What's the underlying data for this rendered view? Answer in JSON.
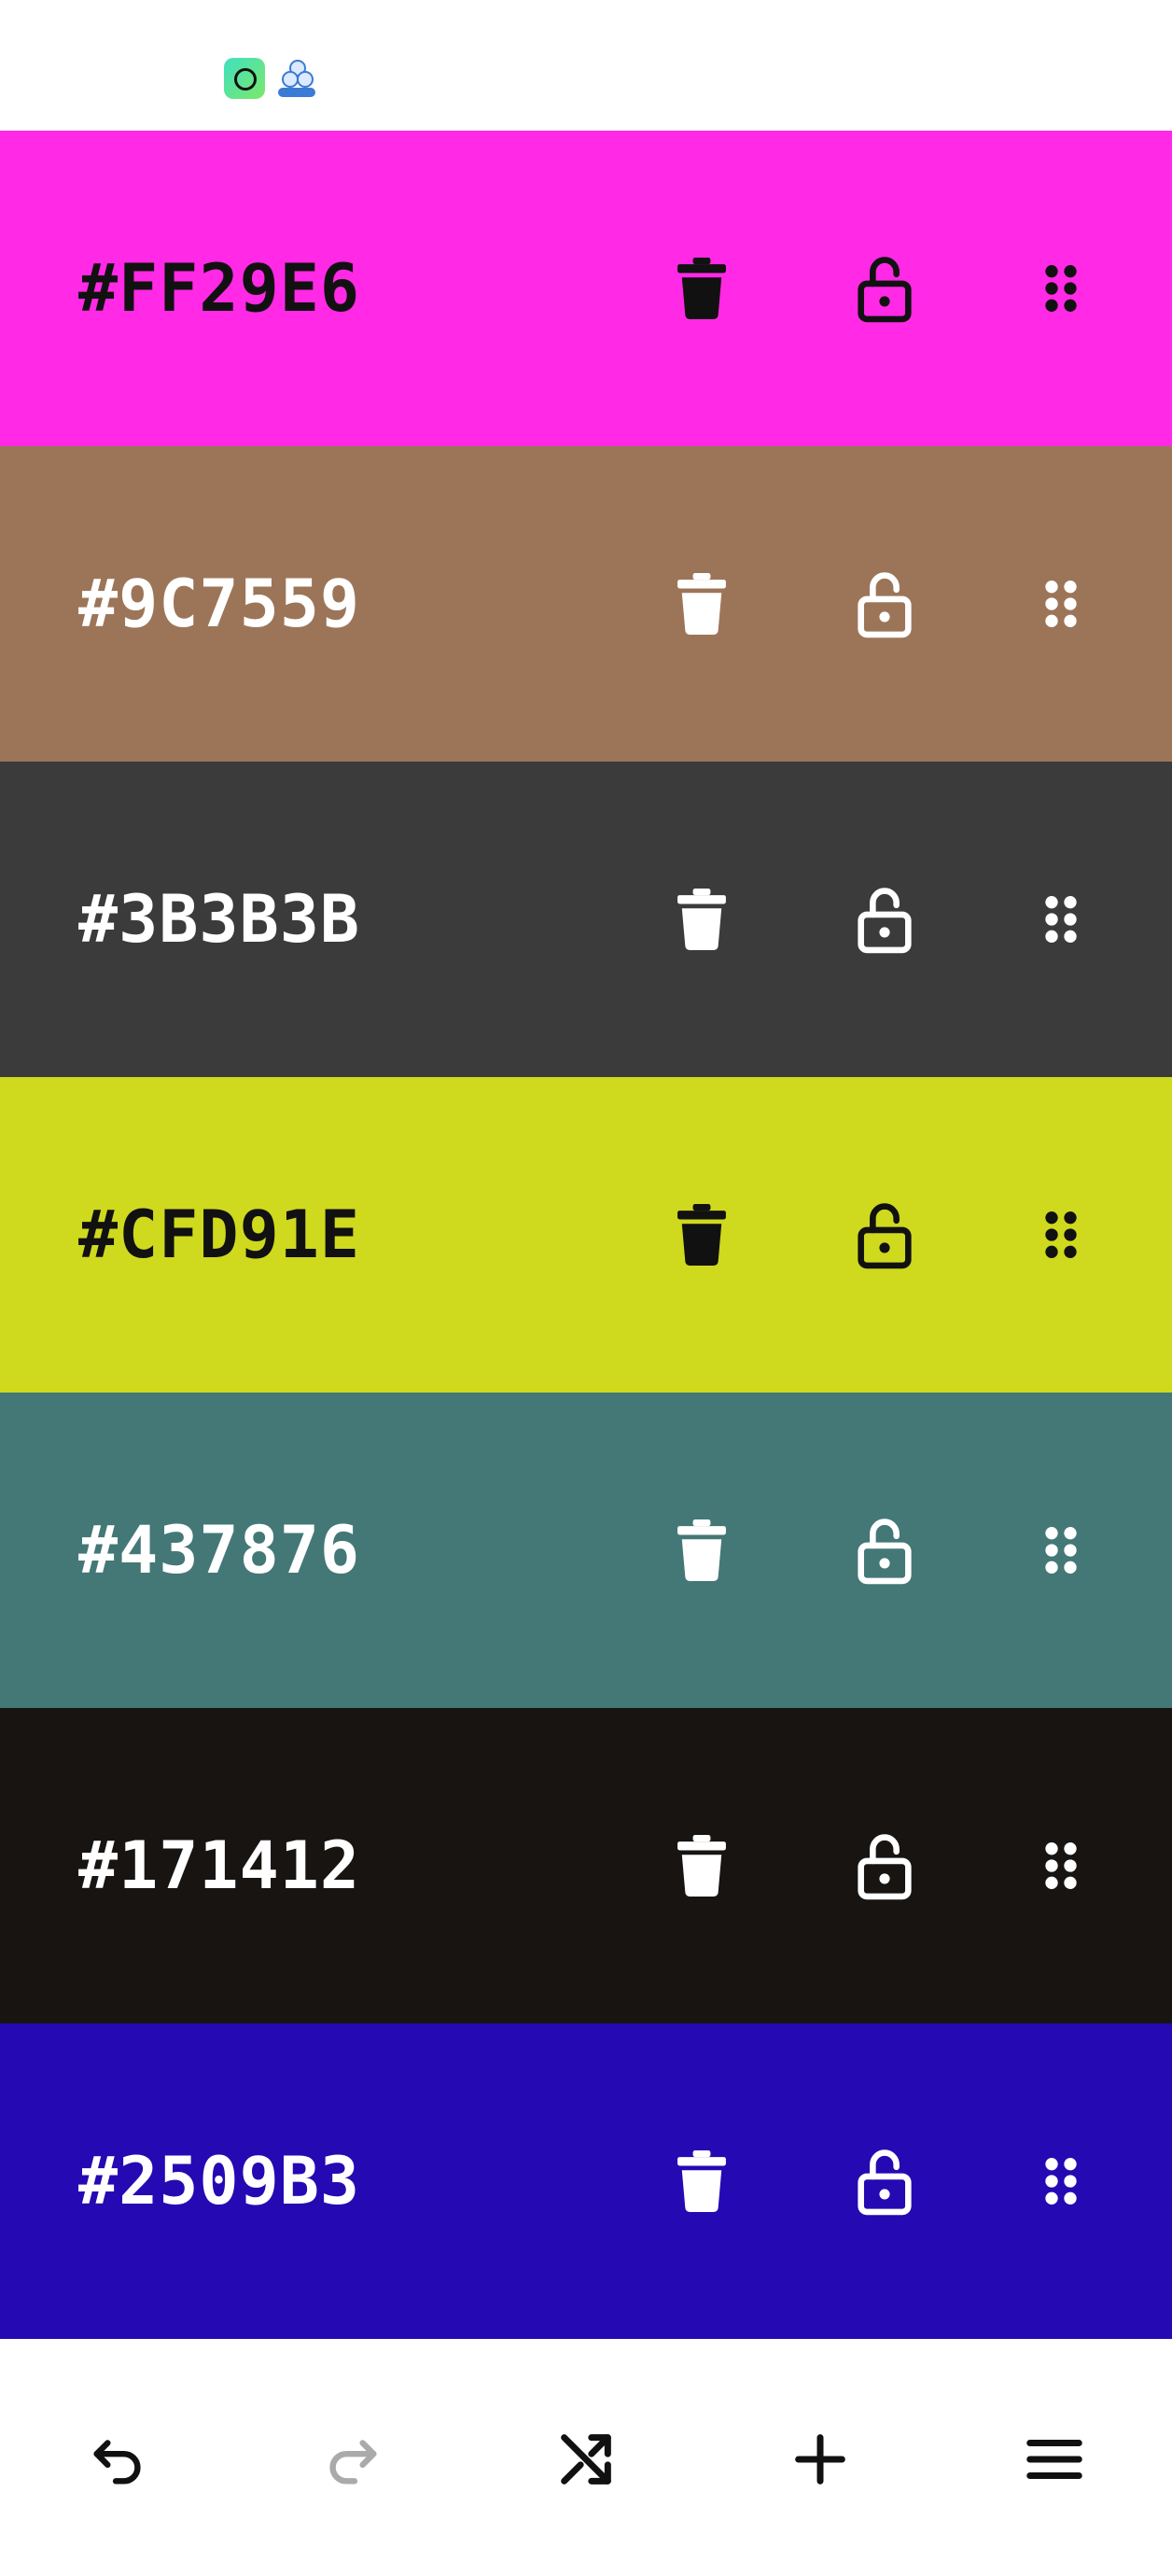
{
  "status_bar": {
    "icons": [
      "camera-app-icon",
      "cluster-app-icon"
    ]
  },
  "swatches": [
    {
      "hex": "#FF29E6",
      "color": "#FF29E6",
      "fg": "#111111"
    },
    {
      "hex": "#9C7559",
      "color": "#9C7559",
      "fg": "#FFFFFF"
    },
    {
      "hex": "#3B3B3B",
      "color": "#3B3B3B",
      "fg": "#FFFFFF"
    },
    {
      "hex": "#CFD91E",
      "color": "#CFD91E",
      "fg": "#111111"
    },
    {
      "hex": "#437876",
      "color": "#437876",
      "fg": "#FFFFFF"
    },
    {
      "hex": "#171412",
      "color": "#171412",
      "fg": "#FFFFFF"
    },
    {
      "hex": "#2509B3",
      "color": "#2509B3",
      "fg": "#FFFFFF"
    }
  ],
  "swatch_icons": {
    "delete": "trash-icon",
    "lock": "unlock-icon",
    "drag": "drag-handle-icon"
  },
  "toolbar": {
    "undo": {
      "icon": "undo-icon",
      "color": "#111111"
    },
    "redo": {
      "icon": "redo-icon",
      "color": "#AAAAAA"
    },
    "shuffle": {
      "icon": "shuffle-icon",
      "color": "#111111"
    },
    "add": {
      "icon": "plus-icon",
      "color": "#111111"
    },
    "menu": {
      "icon": "menu-icon",
      "color": "#111111"
    }
  }
}
